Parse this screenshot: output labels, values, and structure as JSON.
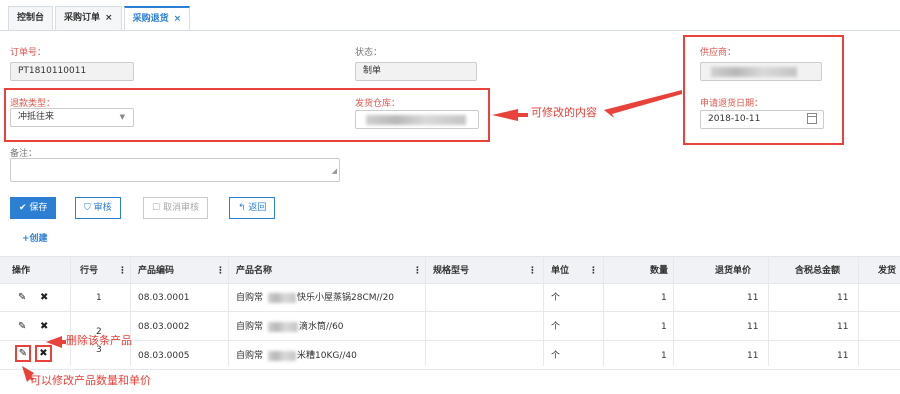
{
  "tabs": [
    {
      "label": "控制台",
      "close": ""
    },
    {
      "label": "采购订单",
      "close": "×"
    },
    {
      "label": "采购退货",
      "close": "×"
    }
  ],
  "form": {
    "order_no_label": "订单号：",
    "order_no_value": "PT1810110011",
    "status_label": "状态：",
    "status_value": "制单",
    "supplier_label": "供应商：",
    "return_type_label": "退款类型：",
    "return_type_value": "冲抵往来",
    "warehouse_label": "发货仓库：",
    "apply_date_label": "申请退货日期：",
    "apply_date_value": "2018-10-11",
    "note_label": "备注："
  },
  "toolbar": {
    "save": "保存",
    "audit": "审核",
    "cancel_audit": "取消审核",
    "back": "返回",
    "create": "+创建"
  },
  "table": {
    "columns": [
      "操作",
      "行号",
      "产品编码",
      "产品名称",
      "规格型号",
      "单位",
      "数量",
      "退货单价",
      "含税总金额",
      "发货"
    ],
    "rows": [
      {
        "line": "1",
        "code": "08.03.0001",
        "name_a": "自购常",
        "name_b": "快乐小屋蒸锅28CM//20",
        "unit": "个",
        "qty": "1",
        "price": "11",
        "total": "11"
      },
      {
        "line": "2",
        "code": "08.03.0002",
        "name_a": "自购常",
        "name_b": "滴水筒//60",
        "unit": "个",
        "qty": "1",
        "price": "11",
        "total": "11"
      },
      {
        "line": "3",
        "code": "08.03.0005",
        "name_a": "自购常",
        "name_b": "米糟10KG//40",
        "unit": "个",
        "qty": "1",
        "price": "11",
        "total": "11"
      }
    ]
  },
  "annotations": {
    "editable": "可修改的内容",
    "delete_row": "删除该条产品",
    "edit_row": "可以修改产品数量和单价"
  },
  "colors": {
    "accent": "#2d7fd4",
    "annotation": "#e8423a"
  }
}
